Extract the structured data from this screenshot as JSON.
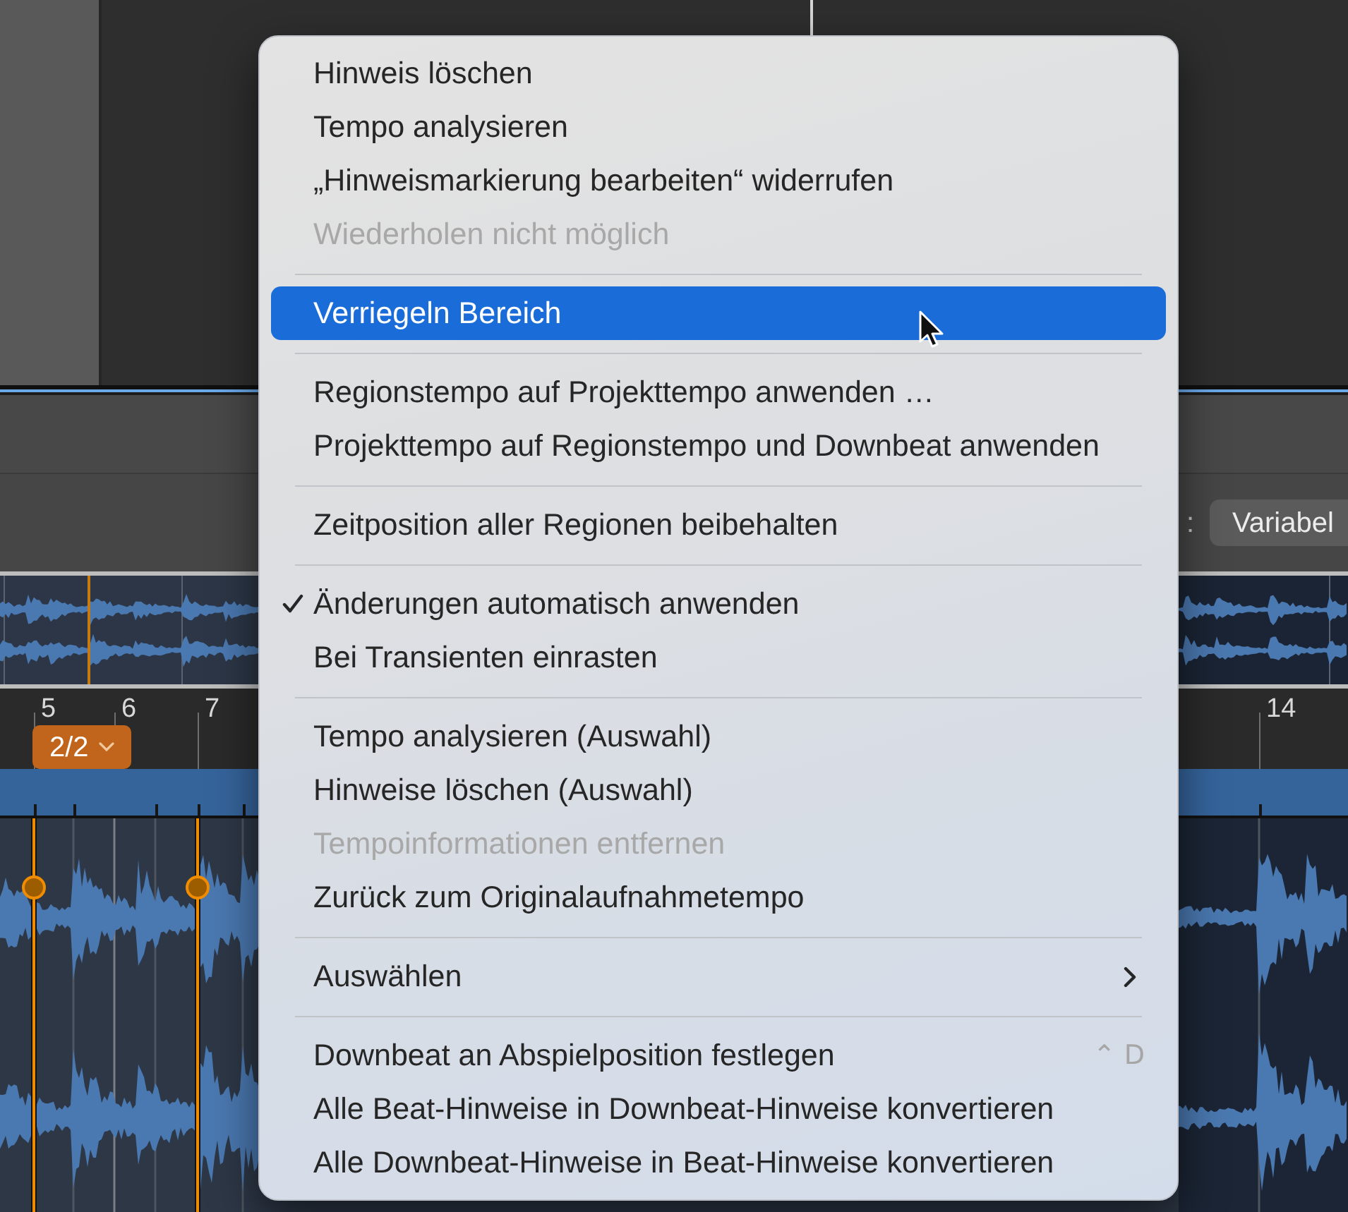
{
  "toolbar": {
    "label": ":",
    "mode_button": "Variabel"
  },
  "ruler": {
    "bars": [
      {
        "label": "5"
      },
      {
        "label": "6"
      },
      {
        "label": "7"
      },
      {
        "label": "14"
      }
    ],
    "signature_badge": "2/2"
  },
  "context_menu": {
    "sections": [
      {
        "items": [
          {
            "label": "Hinweis löschen",
            "kind": "command",
            "disabled": false,
            "checked": false,
            "selected": false
          },
          {
            "label": "Tempo analysieren",
            "kind": "command",
            "disabled": false,
            "checked": false,
            "selected": false
          },
          {
            "label": "„Hinweismarkierung bearbeiten“ widerrufen",
            "kind": "command",
            "disabled": false,
            "checked": false,
            "selected": false
          },
          {
            "label": "Wiederholen nicht möglich",
            "kind": "command",
            "disabled": true,
            "checked": false,
            "selected": false
          }
        ]
      },
      {
        "items": [
          {
            "label": "Verriegeln Bereich",
            "kind": "command",
            "disabled": false,
            "checked": false,
            "selected": true
          }
        ]
      },
      {
        "items": [
          {
            "label": "Regionstempo auf Projekttempo anwenden …",
            "kind": "command",
            "disabled": false,
            "checked": false,
            "selected": false
          },
          {
            "label": "Projekttempo auf Regionstempo und Downbeat anwenden",
            "kind": "command",
            "disabled": false,
            "checked": false,
            "selected": false
          }
        ]
      },
      {
        "items": [
          {
            "label": "Zeitposition aller Regionen beibehalten",
            "kind": "command",
            "disabled": false,
            "checked": false,
            "selected": false
          }
        ]
      },
      {
        "items": [
          {
            "label": "Änderungen automatisch anwenden",
            "kind": "command",
            "disabled": false,
            "checked": true,
            "selected": false
          },
          {
            "label": "Bei Transienten einrasten",
            "kind": "command",
            "disabled": false,
            "checked": false,
            "selected": false
          }
        ]
      },
      {
        "items": [
          {
            "label": "Tempo analysieren (Auswahl)",
            "kind": "command",
            "disabled": false,
            "checked": false,
            "selected": false
          },
          {
            "label": "Hinweise löschen (Auswahl)",
            "kind": "command",
            "disabled": false,
            "checked": false,
            "selected": false
          },
          {
            "label": "Tempoinformationen entfernen",
            "kind": "command",
            "disabled": true,
            "checked": false,
            "selected": false
          },
          {
            "label": "Zurück zum Originalaufnahmetempo",
            "kind": "command",
            "disabled": false,
            "checked": false,
            "selected": false
          }
        ]
      },
      {
        "items": [
          {
            "label": "Auswählen",
            "kind": "submenu",
            "disabled": false,
            "checked": false,
            "selected": false
          }
        ]
      },
      {
        "items": [
          {
            "label": "Downbeat an Abspielposition festlegen",
            "kind": "command",
            "disabled": false,
            "checked": false,
            "selected": false,
            "shortcut": "⌃ D"
          },
          {
            "label": "Alle Beat-Hinweise in Downbeat-Hinweise konvertieren",
            "kind": "command",
            "disabled": false,
            "checked": false,
            "selected": false
          },
          {
            "label": "Alle Downbeat-Hinweise in Beat-Hinweise konvertieren",
            "kind": "command",
            "disabled": false,
            "checked": false,
            "selected": false
          }
        ]
      }
    ]
  }
}
